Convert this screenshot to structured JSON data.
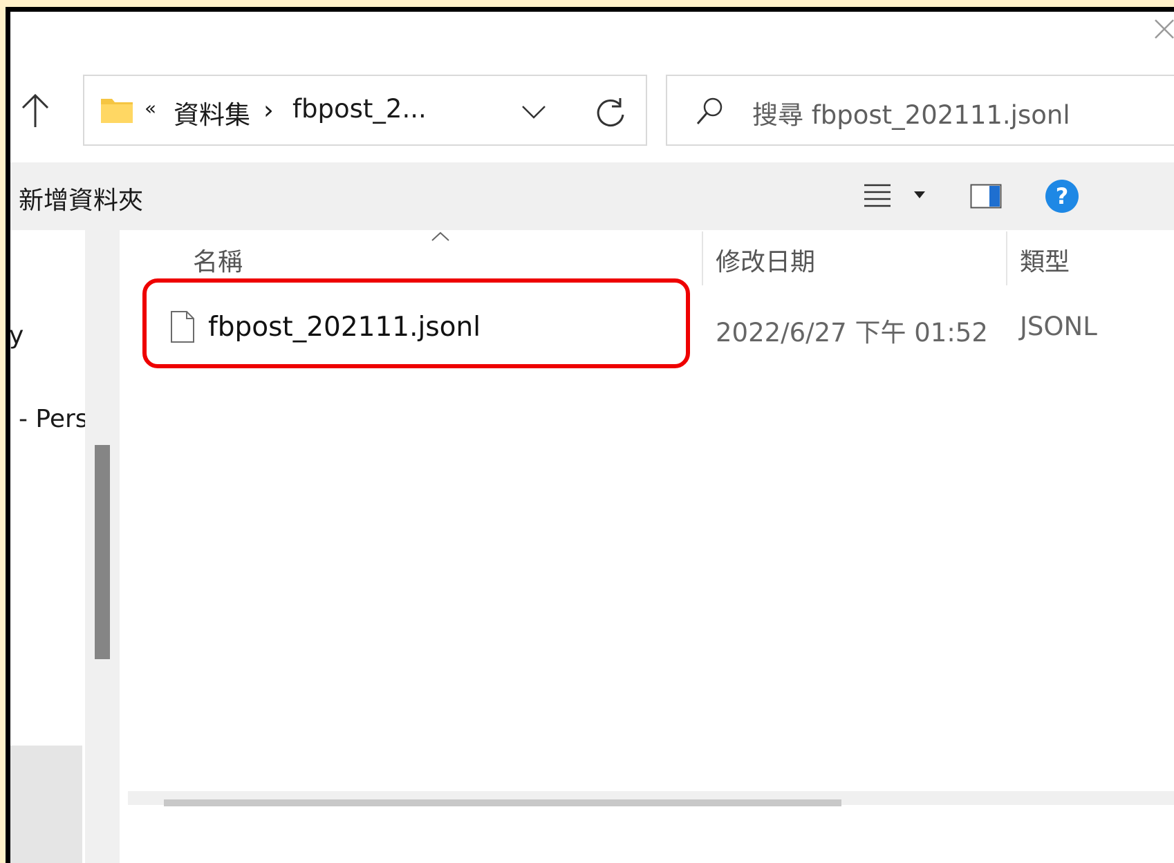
{
  "address_bar": {
    "overflow": "«",
    "crumbs": [
      "資料集",
      "fbpost_2..."
    ],
    "separator": "›"
  },
  "search": {
    "placeholder": "搜尋 fbpost_202111.jsonl"
  },
  "toolbar": {
    "new_folder_label": "新增資料夾",
    "help_label": "?"
  },
  "nav_pane": {
    "partial_items": [
      "y",
      "- Pers"
    ]
  },
  "columns": {
    "name": "名稱",
    "modified": "修改日期",
    "type": "類型"
  },
  "files": [
    {
      "name": "fbpost_202111.jsonl",
      "modified": "2022/6/27 下午 01:52",
      "type": "JSONL"
    }
  ],
  "colors": {
    "highlight": "#ee0000",
    "help": "#1e88e5",
    "folder": "#f5c542",
    "page_border": "#fff1c9"
  }
}
